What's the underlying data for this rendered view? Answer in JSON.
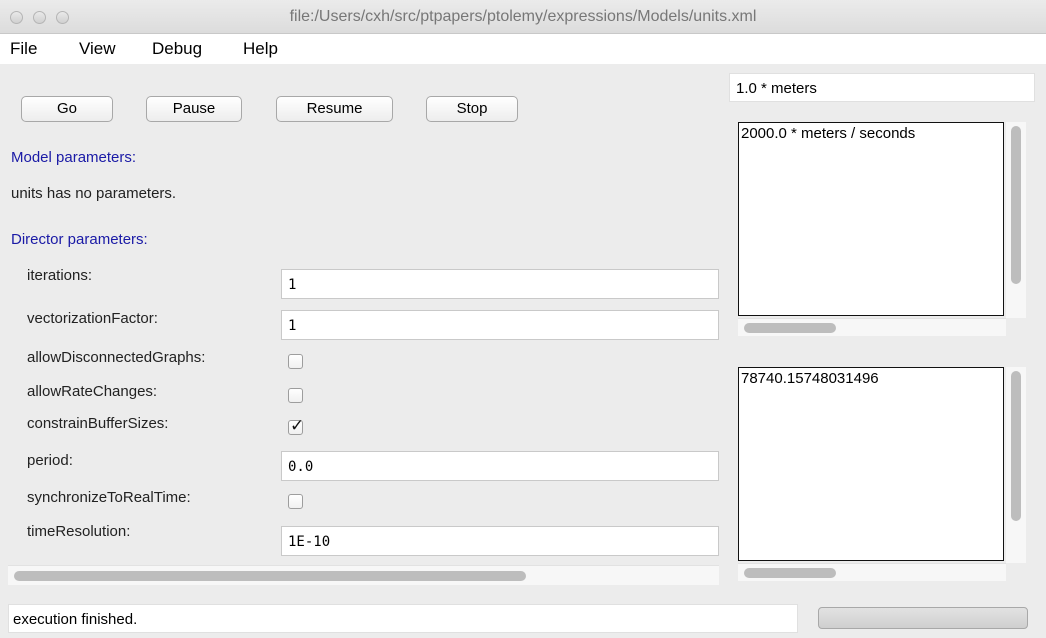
{
  "window": {
    "title": "file:/Users/cxh/src/ptpapers/ptolemy/expressions/Models/units.xml"
  },
  "menu": [
    "File",
    "View",
    "Debug",
    "Help"
  ],
  "buttons": {
    "go": "Go",
    "pause": "Pause",
    "resume": "Resume",
    "stop": "Stop"
  },
  "model": {
    "heading": "Model parameters:",
    "text": "units has no parameters."
  },
  "director": {
    "heading": "Director parameters:",
    "iterations": {
      "label": "iterations:",
      "value": "1"
    },
    "vectorizationFactor": {
      "label": "vectorizationFactor:",
      "value": "1"
    },
    "allowDisconnectedGraphs": {
      "label": "allowDisconnectedGraphs:",
      "checked": false
    },
    "allowRateChanges": {
      "label": "allowRateChanges:",
      "checked": false
    },
    "constrainBufferSizes": {
      "label": "constrainBufferSizes:",
      "checked": true,
      "mark": "✓"
    },
    "period": {
      "label": "period:",
      "value": "0.0"
    },
    "synchronizeToRealTime": {
      "label": "synchronizeToRealTime:",
      "checked": false
    },
    "timeResolution": {
      "label": "timeResolution:",
      "value": "1E-10"
    }
  },
  "outputs": {
    "field": "1.0 * meters",
    "area1": "2000.0 * meters / seconds",
    "area2": "78740.15748031496"
  },
  "status": "execution finished.",
  "colors": {
    "heading": "#1a1aa6",
    "background": "#ececec"
  }
}
